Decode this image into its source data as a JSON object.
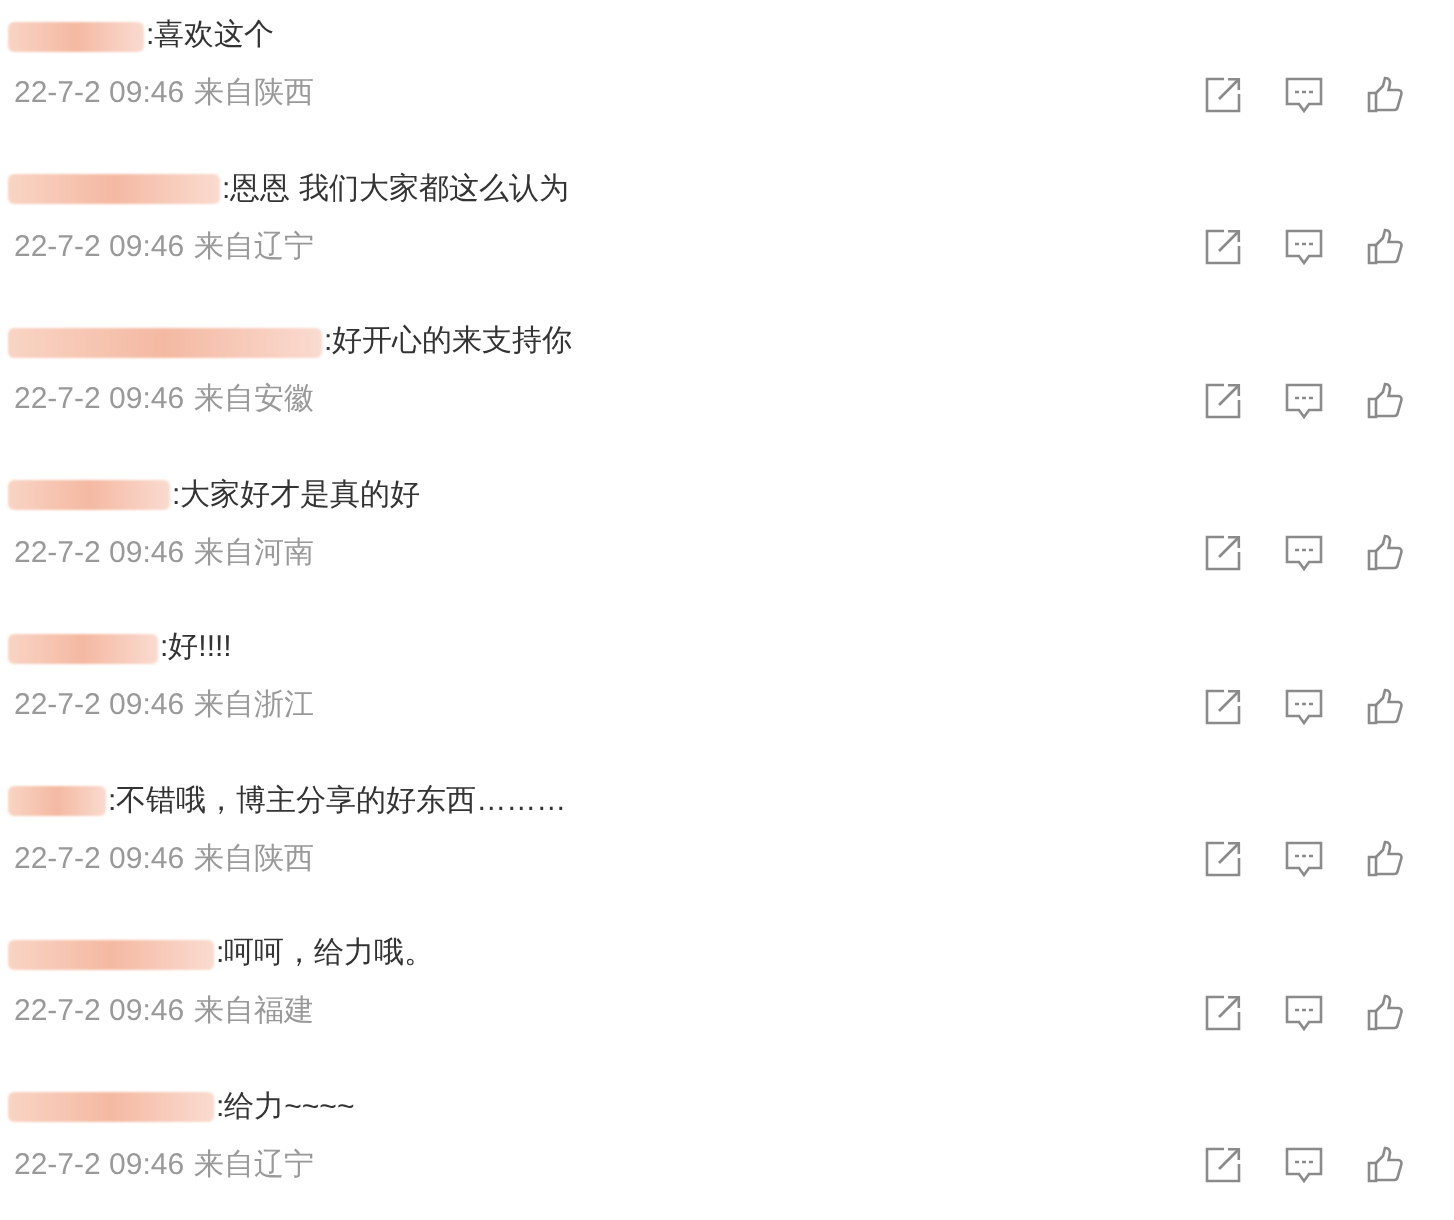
{
  "comments": [
    {
      "text": ":喜欢这个",
      "time": "22-7-2 09:46",
      "location": "来自陕西"
    },
    {
      "text": ":恩恩 我们大家都这么认为",
      "time": "22-7-2 09:46",
      "location": "来自辽宁"
    },
    {
      "text": ":好开心的来支持你",
      "time": "22-7-2 09:46",
      "location": "来自安徽"
    },
    {
      "text": ":大家好才是真的好",
      "time": "22-7-2 09:46",
      "location": "来自河南"
    },
    {
      "text": ":好!!!!",
      "time": "22-7-2 09:46",
      "location": "来自浙江"
    },
    {
      "text": ":不错哦，博主分享的好东西………",
      "time": "22-7-2 09:46",
      "location": "来自陕西"
    },
    {
      "text": ":呵呵，给力哦。",
      "time": "22-7-2 09:46",
      "location": "来自福建"
    },
    {
      "text": ":给力~~~~",
      "time": "22-7-2 09:46",
      "location": "来自辽宁"
    }
  ]
}
